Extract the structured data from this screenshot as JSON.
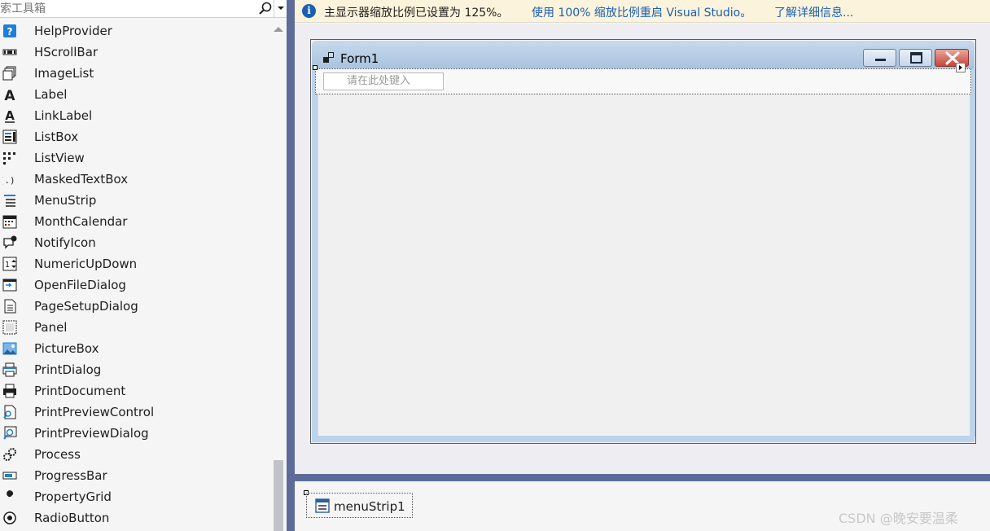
{
  "toolbox": {
    "search_placeholder": "索工具箱",
    "items": [
      {
        "label": "HelpProvider",
        "icon": "help-provider-icon"
      },
      {
        "label": "HScrollBar",
        "icon": "hscrollbar-icon"
      },
      {
        "label": "ImageList",
        "icon": "imagelist-icon"
      },
      {
        "label": "Label",
        "icon": "label-icon"
      },
      {
        "label": "LinkLabel",
        "icon": "linklabel-icon"
      },
      {
        "label": "ListBox",
        "icon": "listbox-icon"
      },
      {
        "label": "ListView",
        "icon": "listview-icon"
      },
      {
        "label": "MaskedTextBox",
        "icon": "maskedtextbox-icon"
      },
      {
        "label": "MenuStrip",
        "icon": "menustrip-icon"
      },
      {
        "label": "MonthCalendar",
        "icon": "monthcalendar-icon"
      },
      {
        "label": "NotifyIcon",
        "icon": "notifyicon-icon"
      },
      {
        "label": "NumericUpDown",
        "icon": "numericupdown-icon"
      },
      {
        "label": "OpenFileDialog",
        "icon": "openfiledialog-icon"
      },
      {
        "label": "PageSetupDialog",
        "icon": "pagesetupdialog-icon"
      },
      {
        "label": "Panel",
        "icon": "panel-icon"
      },
      {
        "label": "PictureBox",
        "icon": "picturebox-icon"
      },
      {
        "label": "PrintDialog",
        "icon": "printdialog-icon"
      },
      {
        "label": "PrintDocument",
        "icon": "printdocument-icon"
      },
      {
        "label": "PrintPreviewControl",
        "icon": "printpreviewcontrol-icon"
      },
      {
        "label": "PrintPreviewDialog",
        "icon": "printpreviewdialog-icon"
      },
      {
        "label": "Process",
        "icon": "process-icon"
      },
      {
        "label": "ProgressBar",
        "icon": "progressbar-icon"
      },
      {
        "label": "PropertyGrid",
        "icon": "propertygrid-icon"
      },
      {
        "label": "RadioButton",
        "icon": "radiobutton-icon"
      }
    ]
  },
  "infobar": {
    "message": "主显示器缩放比例已设置为 125%。",
    "link_restart": "使用 100% 缩放比例重启 Visual Studio。",
    "link_learn": "了解详细信息..."
  },
  "designer": {
    "form_title": "Form1",
    "menu_placeholder": "请在此处键入"
  },
  "tray": {
    "component_label": "menuStrip1"
  },
  "watermark": "CSDN @晚安要温柔",
  "colors": {
    "divider": "#5d6b99",
    "infobar_bg": "#fcf3dc",
    "link": "#1a5fb4"
  }
}
